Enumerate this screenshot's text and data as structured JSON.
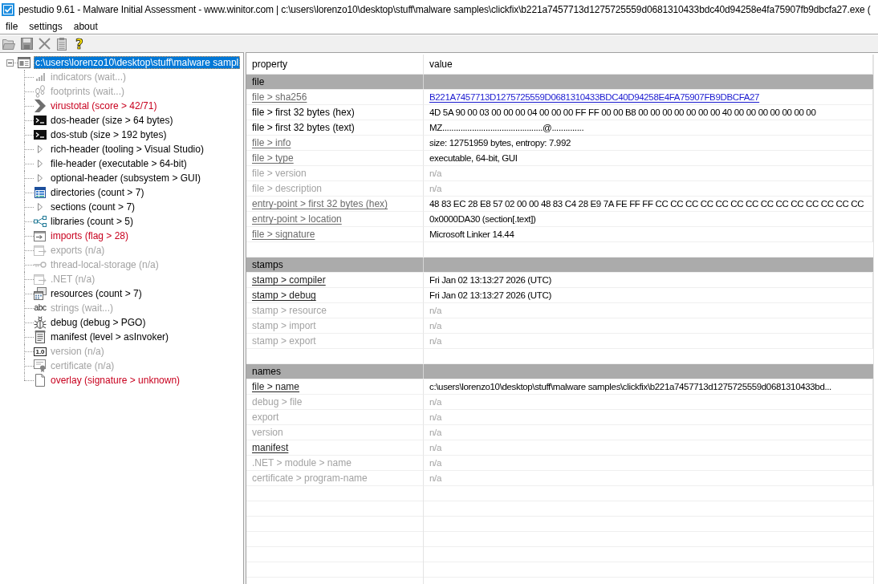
{
  "window": {
    "title": "pestudio 9.61 - Malware Initial Assessment - www.winitor.com | c:\\users\\lorenzo10\\desktop\\stuff\\malware samples\\clickfix\\b221a7457713d1275725559d0681310433bdc40d94258e4fa75907fb9dbcfa27.exe ("
  },
  "menu": [
    "file",
    "settings",
    "about"
  ],
  "toolbar": [
    {
      "kind": "open",
      "disabled": true
    },
    {
      "kind": "save",
      "disabled": true
    },
    {
      "kind": "cut",
      "disabled": true
    },
    {
      "kind": "clipboard",
      "disabled": true
    },
    {
      "kind": "help",
      "glyph": "?",
      "disabled": false
    }
  ],
  "tree": {
    "label": "c:\\users\\lorenzo10\\desktop\\stuff\\malware sampl",
    "selected": true,
    "expanded": true,
    "children": [
      {
        "label": "indicators (wait...)",
        "kind": "bars",
        "disabled": true,
        "flagged": false,
        "selected": false
      },
      {
        "label": "footprints (wait...)",
        "kind": "footprints",
        "disabled": true,
        "flagged": false,
        "selected": false
      },
      {
        "label": "virustotal (score > 42/71)",
        "kind": "chevron",
        "disabled": false,
        "flagged": true,
        "selected": false
      },
      {
        "label": "dos-header (size > 64 bytes)",
        "kind": "console",
        "disabled": false,
        "flagged": false,
        "selected": false
      },
      {
        "label": "dos-stub (size > 192 bytes)",
        "kind": "console",
        "disabled": false,
        "flagged": false,
        "selected": false
      },
      {
        "label": "rich-header (tooling > Visual Studio)",
        "kind": "triangle",
        "disabled": false,
        "flagged": false,
        "selected": false
      },
      {
        "label": "file-header (executable > 64-bit)",
        "kind": "triangle",
        "disabled": false,
        "flagged": false,
        "selected": false
      },
      {
        "label": "optional-header (subsystem > GUI)",
        "kind": "triangle",
        "disabled": false,
        "flagged": false,
        "selected": false
      },
      {
        "label": "directories (count > 7)",
        "kind": "grid",
        "disabled": false,
        "flagged": false,
        "selected": false
      },
      {
        "label": "sections (count > 7)",
        "kind": "triangle",
        "disabled": false,
        "flagged": false,
        "selected": false
      },
      {
        "label": "libraries (count > 5)",
        "kind": "nodes",
        "disabled": false,
        "flagged": false,
        "selected": false
      },
      {
        "label": "imports (flag > 28)",
        "kind": "inbox",
        "disabled": false,
        "flagged": true,
        "selected": false
      },
      {
        "label": "exports (n/a)",
        "kind": "outbox",
        "disabled": true,
        "flagged": false,
        "selected": false
      },
      {
        "label": "thread-local-storage (n/a)",
        "kind": "key",
        "disabled": true,
        "flagged": false,
        "selected": false
      },
      {
        "label": ".NET (n/a)",
        "kind": "outbox",
        "disabled": true,
        "flagged": false,
        "selected": false
      },
      {
        "label": "resources (count > 7)",
        "kind": "windows",
        "disabled": false,
        "flagged": false,
        "selected": false
      },
      {
        "label": "strings (wait...)",
        "kind": "lettering",
        "icon_text": "abc",
        "disabled": true,
        "flagged": false,
        "selected": false
      },
      {
        "label": "debug (debug > PGO)",
        "kind": "bug",
        "disabled": false,
        "flagged": false,
        "selected": false
      },
      {
        "label": "manifest (level > asInvoker)",
        "kind": "document",
        "disabled": false,
        "flagged": false,
        "selected": false
      },
      {
        "label": "version (n/a)",
        "kind": "numbox",
        "icon_text": "1.0",
        "disabled": true,
        "flagged": false,
        "selected": false
      },
      {
        "label": "certificate (n/a)",
        "kind": "certificate",
        "disabled": true,
        "flagged": false,
        "selected": false
      },
      {
        "label": "overlay (signature > unknown)",
        "kind": "page",
        "disabled": false,
        "flagged": true,
        "selected": false
      }
    ]
  },
  "table": {
    "columns": [
      "property",
      "value"
    ],
    "sections": [
      {
        "title": "file",
        "rows": [
          {
            "property": {
              "text": "file > sha256",
              "kind": "greylink"
            },
            "value": {
              "text": "B221A7457713D1275725559D0681310433BDC40D94258E4FA75907FB9DBCFA27",
              "kind": "link"
            }
          },
          {
            "property": {
              "text": "file > first 32 bytes (hex)",
              "kind": "plain"
            },
            "value": {
              "text": "4D 5A 90 00 03 00 00 00 04 00 00 00 FF FF 00 00 B8 00 00 00 00 00 00 00 40 00 00 00 00 00 00 00",
              "kind": "plain"
            }
          },
          {
            "property": {
              "text": "file > first 32 bytes (text)",
              "kind": "plain"
            },
            "value": {
              "text": "MZ............................................@..............",
              "kind": "plain"
            }
          },
          {
            "property": {
              "text": "file > info",
              "kind": "greylink"
            },
            "value": {
              "text": "size: 12751959 bytes, entropy: 7.992",
              "kind": "plain"
            }
          },
          {
            "property": {
              "text": "file > type",
              "kind": "greylink"
            },
            "value": {
              "text": "executable, 64-bit, GUI",
              "kind": "plain"
            }
          },
          {
            "property": {
              "text": "file > version",
              "kind": "disabled"
            },
            "value": {
              "text": "n/a",
              "kind": "disabled"
            }
          },
          {
            "property": {
              "text": "file > description",
              "kind": "disabled"
            },
            "value": {
              "text": "n/a",
              "kind": "disabled"
            }
          },
          {
            "property": {
              "text": "entry-point > first 32 bytes (hex)",
              "kind": "greylink"
            },
            "value": {
              "text": "48 83 EC 28 E8 57 02 00 00 48 83 C4 28 E9 7A FE FF FF CC CC CC CC CC CC CC CC CC CC CC CC CC CC",
              "kind": "plain"
            }
          },
          {
            "property": {
              "text": "entry-point > location",
              "kind": "greylink"
            },
            "value": {
              "text": "0x0000DA30 (section[.text])",
              "kind": "plain"
            }
          },
          {
            "property": {
              "text": "file > signature",
              "kind": "greylink"
            },
            "value": {
              "text": "Microsoft Linker 14.44",
              "kind": "plain"
            }
          }
        ]
      },
      {
        "title": "stamps",
        "rows": [
          {
            "property": {
              "text": "stamp > compiler",
              "kind": "link"
            },
            "value": {
              "text": "Fri Jan 02 13:13:27 2026 (UTC)",
              "kind": "plain"
            }
          },
          {
            "property": {
              "text": "stamp > debug",
              "kind": "link"
            },
            "value": {
              "text": "Fri Jan 02 13:13:27 2026 (UTC)",
              "kind": "plain"
            }
          },
          {
            "property": {
              "text": "stamp > resource",
              "kind": "disabled"
            },
            "value": {
              "text": "n/a",
              "kind": "disabled"
            }
          },
          {
            "property": {
              "text": "stamp > import",
              "kind": "disabled"
            },
            "value": {
              "text": "n/a",
              "kind": "disabled"
            }
          },
          {
            "property": {
              "text": "stamp > export",
              "kind": "disabled"
            },
            "value": {
              "text": "n/a",
              "kind": "disabled"
            }
          }
        ]
      },
      {
        "title": "names",
        "rows": [
          {
            "property": {
              "text": "file > name",
              "kind": "link"
            },
            "value": {
              "text": "c:\\users\\lorenzo10\\desktop\\stuff\\malware samples\\clickfix\\b221a7457713d1275725559d0681310433bd...",
              "kind": "plain"
            }
          },
          {
            "property": {
              "text": "debug > file",
              "kind": "disabled"
            },
            "value": {
              "text": "n/a",
              "kind": "disabled"
            }
          },
          {
            "property": {
              "text": "export",
              "kind": "disabled"
            },
            "value": {
              "text": "n/a",
              "kind": "disabled"
            }
          },
          {
            "property": {
              "text": "version",
              "kind": "disabled"
            },
            "value": {
              "text": "n/a",
              "kind": "disabled"
            }
          },
          {
            "property": {
              "text": "manifest",
              "kind": "link"
            },
            "value": {
              "text": "n/a",
              "kind": "disabled"
            }
          },
          {
            "property": {
              "text": ".NET > module > name",
              "kind": "disabled"
            },
            "value": {
              "text": "n/a",
              "kind": "disabled"
            }
          },
          {
            "property": {
              "text": "certificate > program-name",
              "kind": "disabled"
            },
            "value": {
              "text": "n/a",
              "kind": "disabled"
            }
          }
        ]
      }
    ]
  }
}
